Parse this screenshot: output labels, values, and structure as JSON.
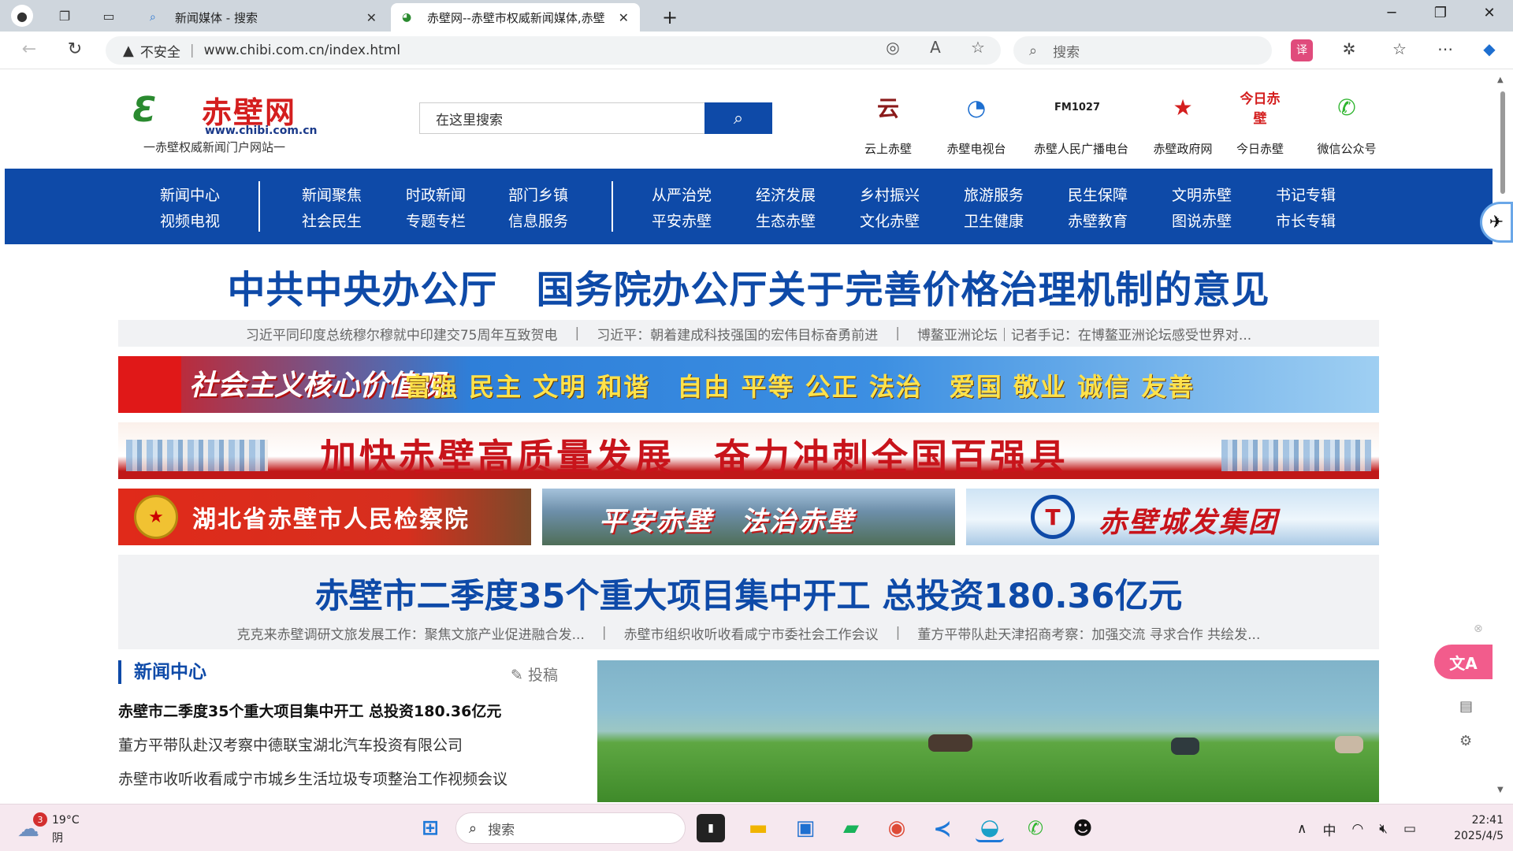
{
  "browser": {
    "tabs": [
      {
        "title": "新闻媒体 - 搜索"
      },
      {
        "title": "赤壁网--赤壁市权威新闻媒体,赤壁"
      }
    ],
    "address": {
      "security": "不安全",
      "url": "www.chibi.com.cn/index.html"
    },
    "search_placeholder": "搜索"
  },
  "site": {
    "logo": {
      "name": "赤壁网",
      "domain": "www.chibi.com.cn",
      "slogan": "一赤壁权威新闻门户网站一"
    },
    "search": {
      "placeholder": "在这里搜索"
    },
    "links": [
      {
        "label": "云上赤壁",
        "glyph": "云",
        "color": "#8b1a1a"
      },
      {
        "label": "赤壁电视台",
        "glyph": "◔",
        "color": "#1e6fd0"
      },
      {
        "label": "赤壁人民广播电台",
        "glyph": "FM1027",
        "color": "#222222"
      },
      {
        "label": "赤壁政府网",
        "glyph": "★",
        "color": "#d41e1e"
      },
      {
        "label": "今日赤壁",
        "glyph": "今日赤壁",
        "color": "#d41e1e"
      },
      {
        "label": "微信公众号",
        "glyph": "✆",
        "color": "#2fb52f"
      }
    ],
    "nav": [
      [
        "新闻中心",
        "视频电视"
      ],
      [
        "新闻聚焦",
        "社会民生"
      ],
      [
        "时政新闻",
        "专题专栏"
      ],
      [
        "部门乡镇",
        "信息服务"
      ],
      [
        "从严治党",
        "平安赤壁"
      ],
      [
        "经济发展",
        "生态赤壁"
      ],
      [
        "乡村振兴",
        "文化赤壁"
      ],
      [
        "旅游服务",
        "卫生健康"
      ],
      [
        "民生保障",
        "赤壁教育"
      ],
      [
        "文明赤壁",
        "图说赤壁"
      ],
      [
        "书记专辑",
        "市长专辑"
      ]
    ],
    "headline": "中共中央办公厅　国务院办公厅关于完善价格治理机制的意见",
    "sub_headlines": [
      "习近平同印度总统穆尔穆就中印建交75周年互致贺电",
      "习近平：朝着建成科技强国的宏伟目标奋勇前进",
      "博鳌亚洲论坛｜记者手记：在博鳌亚洲论坛感受世界对..."
    ],
    "banners": {
      "core_values_tag": "社会主义核心价值观",
      "core_values": "富强 民主 文明 和谐　自由 平等 公正 法治　爱国 敬业 诚信 友善",
      "development": "加快赤壁高质量发展　奋力冲刺全国百强县",
      "procuratorate": "湖北省赤壁市人民检察院",
      "safe_chibi": "平安赤壁　法治赤壁",
      "urban_dev": "赤壁城发集团"
    },
    "feature_title": "赤壁市二季度35个重大项目集中开工 总投资180.36亿元",
    "feature_subs": [
      "克克来赤壁调研文旅发展工作：聚焦文旅产业促进融合发...",
      "赤壁市组织收听收看咸宁市委社会工作会议",
      "董方平带队赴天津招商考察：加强交流 寻求合作 共绘发..."
    ],
    "news_center": {
      "title": "新闻中心",
      "submit": "投稿",
      "items": [
        "赤壁市二季度35个重大项目集中开工 总投资180.36亿元",
        "董方平带队赴汉考察中德联宝湖北汽车投资有限公司",
        "赤壁市收听收看咸宁市城乡生活垃圾专项整治工作视频会议"
      ]
    }
  },
  "taskbar": {
    "weather": {
      "badge": "3",
      "temp": "19°C",
      "cond": "阴"
    },
    "search_placeholder": "搜索",
    "ime": "中",
    "time": "22:41",
    "date": "2025/4/5"
  }
}
